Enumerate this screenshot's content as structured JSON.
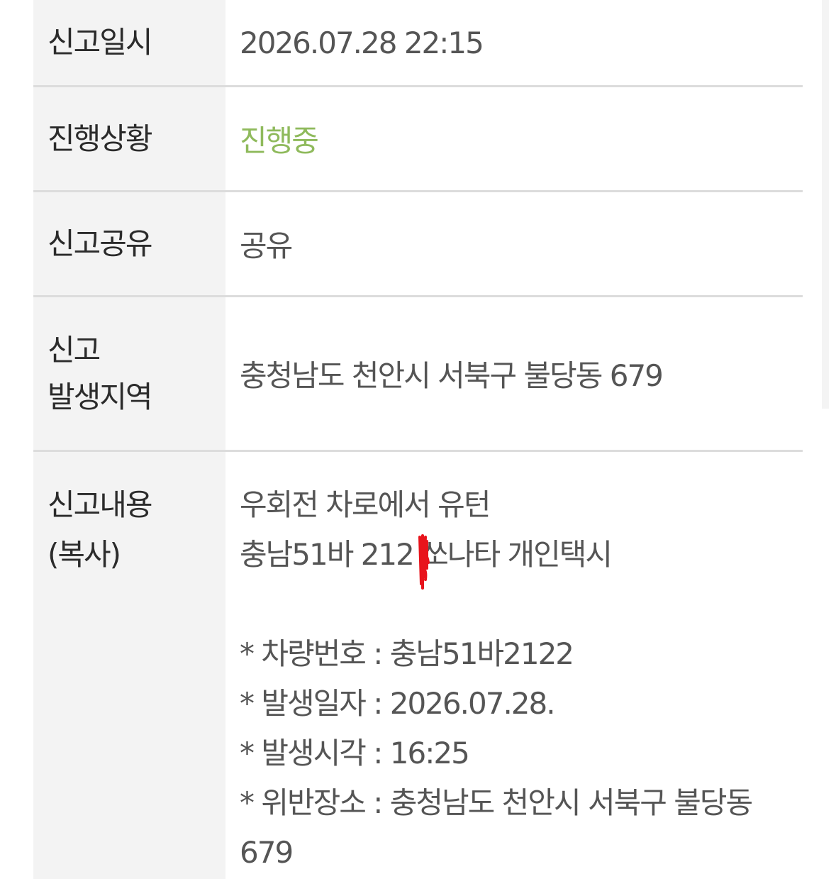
{
  "rows": [
    {
      "label": "신고일시",
      "value": "2026.07.28 22:15"
    },
    {
      "label": "진행상황",
      "value": "진행중",
      "value_color": "#8fba5c"
    },
    {
      "label": "신고공유",
      "value": "공유"
    },
    {
      "label_line1": "신고",
      "label_line2": "발생지역",
      "value": "충청남도 천안시 서북구 불당동 679"
    },
    {
      "label_line1": "신고내용",
      "label_line2": "(복사)",
      "content": {
        "line1": "우회전 차로에서 유턴",
        "line2_prefix": "충남51바 212",
        "line2_suffix": " 쏘나타 개인택시",
        "vehicle_number": "* 차량번호 : 충남51바2122",
        "date": "* 발생일자 : 2026.07.28.",
        "time": "* 발생시각 : 16:25",
        "location": "* 위반장소 : 충청남도 천안시 서북구 불당동",
        "location_cont": "679"
      }
    }
  ],
  "colors": {
    "label_bg": "#f3f3f3",
    "divider": "#dcdcdc",
    "label_text": "#2b2b2b",
    "value_text": "#555555",
    "status_green": "#8fba5c",
    "redaction_mark": "#e8141c"
  }
}
